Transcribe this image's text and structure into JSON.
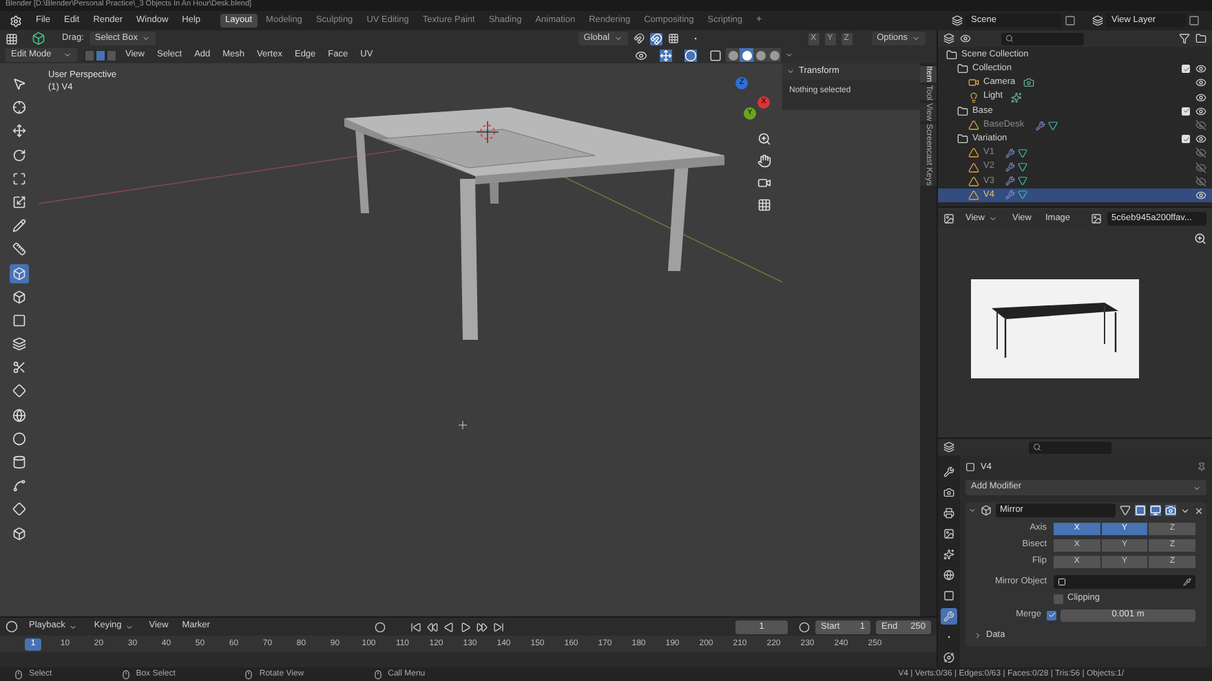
{
  "title_bar": {
    "title": "Blender [D:\\Blender\\Personal Practice\\_3 Objects In An Hour\\Desk.blend]"
  },
  "menu": [
    "File",
    "Edit",
    "Render",
    "Window",
    "Help"
  ],
  "workspaces": [
    {
      "label": "Layout",
      "selected": true
    },
    {
      "label": "Modeling",
      "selected": false
    },
    {
      "label": "Sculpting",
      "selected": false
    },
    {
      "label": "UV Editing",
      "selected": false
    },
    {
      "label": "Texture Paint",
      "selected": false
    },
    {
      "label": "Shading",
      "selected": false
    },
    {
      "label": "Animation",
      "selected": false
    },
    {
      "label": "Rendering",
      "selected": false
    },
    {
      "label": "Compositing",
      "selected": false
    },
    {
      "label": "Scripting",
      "selected": false
    }
  ],
  "add_workspace": "+",
  "scene": "Scene",
  "view_layer": "View Layer",
  "viewport": {
    "drag_label": "Drag:",
    "select_tool": "Select Box",
    "orientation": "Global",
    "mirror_axes": [
      "X",
      "Y",
      "Z"
    ],
    "options": "Options",
    "mode": "Edit Mode",
    "select_modes": [
      {
        "selected": false
      },
      {
        "selected": true
      },
      {
        "selected": false
      }
    ],
    "menus": [
      "View",
      "Select",
      "Add",
      "Mesh",
      "Vertex",
      "Edge",
      "Face",
      "UV"
    ],
    "shading_modes": [
      {
        "selected": false
      },
      {
        "selected": true
      },
      {
        "selected": false
      },
      {
        "selected": false
      }
    ],
    "view_name": "User Perspective",
    "object_label": "(1) V4",
    "tools": [
      {
        "selected": false
      },
      {
        "selected": false
      },
      {
        "selected": false
      },
      {
        "selected": false
      },
      {
        "selected": false
      },
      {
        "selected": false
      },
      {
        "selected": false
      },
      {
        "selected": false
      },
      {
        "selected": true
      },
      {
        "selected": false
      },
      {
        "selected": false
      },
      {
        "selected": false
      },
      {
        "selected": false
      },
      {
        "selected": false
      },
      {
        "selected": false
      },
      {
        "selected": false
      },
      {
        "selected": false
      },
      {
        "selected": false
      },
      {
        "selected": false
      },
      {
        "selected": false
      }
    ],
    "gizmo": [
      {
        "label": "Z",
        "color": "#2e6fd8"
      },
      {
        "label": "X",
        "color": "#d8343a"
      },
      {
        "label": "Y",
        "color": "#6aa521"
      }
    ],
    "sidebar": {
      "panel": "Transform",
      "text": "Nothing selected",
      "tabs": [
        {
          "label": "Item",
          "selected": true
        },
        {
          "label": "Tool",
          "selected": false
        },
        {
          "label": "View",
          "selected": false
        },
        {
          "label": "Screencast Keys",
          "selected": false
        }
      ]
    }
  },
  "timeline": {
    "menus": [
      "Playback",
      "Keying",
      "View",
      "Marker"
    ],
    "current_frame": "1",
    "start_label": "Start",
    "start": "1",
    "end_label": "End",
    "end": "250",
    "ticks": [
      {
        "label": "1",
        "selected": true
      },
      {
        "label": "10",
        "selected": false
      },
      {
        "label": "20",
        "selected": false
      },
      {
        "label": "30",
        "selected": false
      },
      {
        "label": "40",
        "selected": false
      },
      {
        "label": "50",
        "selected": false
      },
      {
        "label": "60",
        "selected": false
      },
      {
        "label": "70",
        "selected": false
      },
      {
        "label": "80",
        "selected": false
      },
      {
        "label": "90",
        "selected": false
      },
      {
        "label": "100",
        "selected": false
      },
      {
        "label": "110",
        "selected": false
      },
      {
        "label": "120",
        "selected": false
      },
      {
        "label": "130",
        "selected": false
      },
      {
        "label": "140",
        "selected": false
      },
      {
        "label": "150",
        "selected": false
      },
      {
        "label": "160",
        "selected": false
      },
      {
        "label": "170",
        "selected": false
      },
      {
        "label": "180",
        "selected": false
      },
      {
        "label": "190",
        "selected": false
      },
      {
        "label": "200",
        "selected": false
      },
      {
        "label": "210",
        "selected": false
      },
      {
        "label": "220",
        "selected": false
      },
      {
        "label": "230",
        "selected": false
      },
      {
        "label": "240",
        "selected": false
      },
      {
        "label": "250",
        "selected": false
      }
    ]
  },
  "outliner": {
    "tree": [
      {
        "label": "Scene Collection",
        "kind": "scene",
        "children": [
          {
            "label": "Collection",
            "kind": "collection",
            "checked": true,
            "visible": true,
            "selected": false,
            "children": [
              {
                "label": "Camera",
                "kind": "camera",
                "visible": true,
                "selected": false
              },
              {
                "label": "Light",
                "kind": "light",
                "visible": true,
                "selected": false
              }
            ]
          },
          {
            "label": "Base",
            "kind": "collection",
            "checked": true,
            "visible": true,
            "selected": false,
            "children": [
              {
                "label": "BaseDesk",
                "kind": "mesh",
                "visible": false,
                "selected": false
              }
            ]
          },
          {
            "label": "Variation",
            "kind": "collection",
            "checked": true,
            "visible": true,
            "selected": false,
            "children": [
              {
                "label": "V1",
                "kind": "mesh",
                "visible": false,
                "selected": false
              },
              {
                "label": "V2",
                "kind": "mesh",
                "visible": false,
                "selected": false
              },
              {
                "label": "V3",
                "kind": "mesh",
                "visible": false,
                "selected": false
              },
              {
                "label": "V4",
                "kind": "mesh",
                "visible": true,
                "selected": true
              }
            ]
          }
        ]
      }
    ]
  },
  "image_editor": {
    "menus": [
      "View",
      "View",
      "Image"
    ],
    "image_name": "5c6eb945a200ffav..."
  },
  "properties": {
    "tabs": [
      {
        "selected": false
      },
      {
        "selected": false
      },
      {
        "selected": false
      },
      {
        "selected": false
      },
      {
        "selected": false
      },
      {
        "selected": false
      },
      {
        "selected": false
      },
      {
        "selected": true
      },
      {
        "selected": false
      },
      {
        "selected": false
      }
    ],
    "object_name": "V4",
    "add_modifier": "Add Modifier",
    "modifier": {
      "name": "Mirror",
      "expanded": true,
      "rows": [
        {
          "label": "Axis",
          "options": [
            {
              "label": "X",
              "selected": true
            },
            {
              "label": "Y",
              "selected": true
            },
            {
              "label": "Z",
              "selected": false
            }
          ]
        },
        {
          "label": "Bisect",
          "options": [
            {
              "label": "X",
              "selected": false
            },
            {
              "label": "Y",
              "selected": false
            },
            {
              "label": "Z",
              "selected": false
            }
          ]
        },
        {
          "label": "Flip",
          "options": [
            {
              "label": "X",
              "selected": false
            },
            {
              "label": "Y",
              "selected": false
            },
            {
              "label": "Z",
              "selected": false
            }
          ]
        }
      ],
      "mirror_object_label": "Mirror Object",
      "clipping": {
        "label": "Clipping",
        "checked": false
      },
      "merge": {
        "label": "Merge",
        "checked": true,
        "value": "0.001 m"
      },
      "data": {
        "label": "Data",
        "expanded": false
      }
    }
  },
  "status_bar": {
    "items": [
      "Select",
      "Box Select",
      "Rotate View",
      "Call Menu"
    ],
    "stats": "V4 | Verts:0/36 | Edges:0/63 | Faces:0/28 | Tris:56 | Objects:1/"
  }
}
